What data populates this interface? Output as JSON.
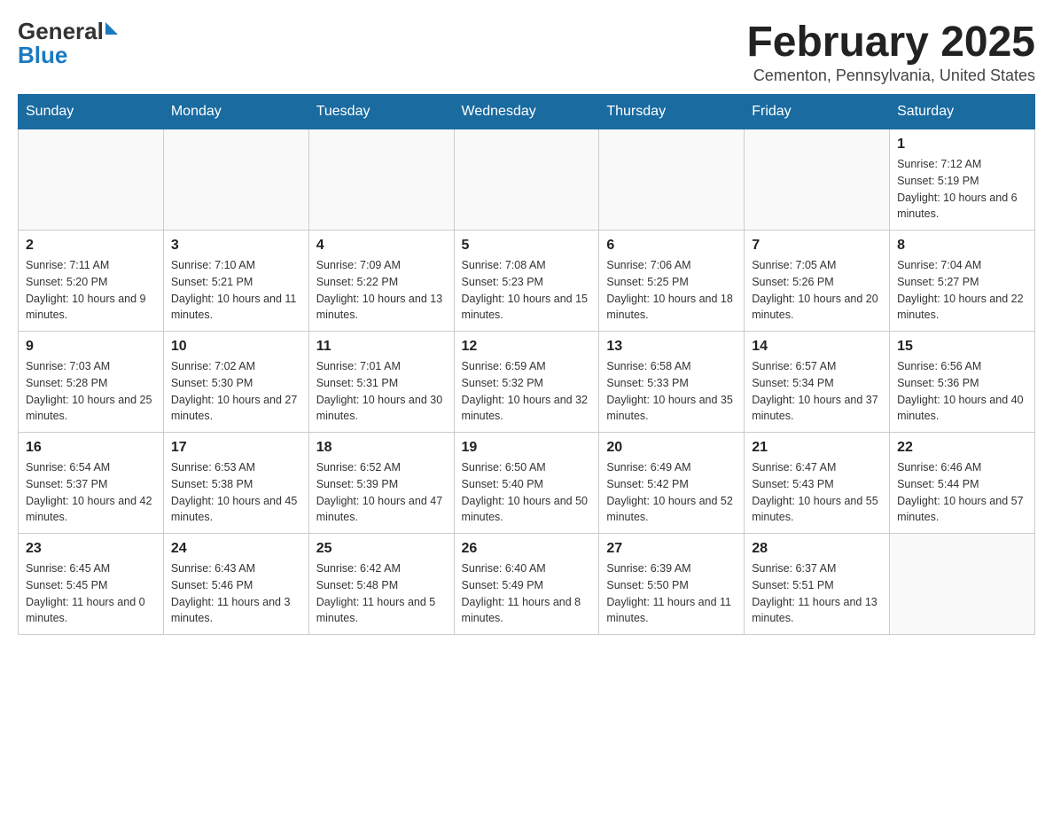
{
  "header": {
    "logo_general": "General",
    "logo_blue": "Blue",
    "title": "February 2025",
    "location": "Cementon, Pennsylvania, United States"
  },
  "days_of_week": [
    "Sunday",
    "Monday",
    "Tuesday",
    "Wednesday",
    "Thursday",
    "Friday",
    "Saturday"
  ],
  "weeks": [
    [
      {
        "day": "",
        "info": ""
      },
      {
        "day": "",
        "info": ""
      },
      {
        "day": "",
        "info": ""
      },
      {
        "day": "",
        "info": ""
      },
      {
        "day": "",
        "info": ""
      },
      {
        "day": "",
        "info": ""
      },
      {
        "day": "1",
        "info": "Sunrise: 7:12 AM\nSunset: 5:19 PM\nDaylight: 10 hours and 6 minutes."
      }
    ],
    [
      {
        "day": "2",
        "info": "Sunrise: 7:11 AM\nSunset: 5:20 PM\nDaylight: 10 hours and 9 minutes."
      },
      {
        "day": "3",
        "info": "Sunrise: 7:10 AM\nSunset: 5:21 PM\nDaylight: 10 hours and 11 minutes."
      },
      {
        "day": "4",
        "info": "Sunrise: 7:09 AM\nSunset: 5:22 PM\nDaylight: 10 hours and 13 minutes."
      },
      {
        "day": "5",
        "info": "Sunrise: 7:08 AM\nSunset: 5:23 PM\nDaylight: 10 hours and 15 minutes."
      },
      {
        "day": "6",
        "info": "Sunrise: 7:06 AM\nSunset: 5:25 PM\nDaylight: 10 hours and 18 minutes."
      },
      {
        "day": "7",
        "info": "Sunrise: 7:05 AM\nSunset: 5:26 PM\nDaylight: 10 hours and 20 minutes."
      },
      {
        "day": "8",
        "info": "Sunrise: 7:04 AM\nSunset: 5:27 PM\nDaylight: 10 hours and 22 minutes."
      }
    ],
    [
      {
        "day": "9",
        "info": "Sunrise: 7:03 AM\nSunset: 5:28 PM\nDaylight: 10 hours and 25 minutes."
      },
      {
        "day": "10",
        "info": "Sunrise: 7:02 AM\nSunset: 5:30 PM\nDaylight: 10 hours and 27 minutes."
      },
      {
        "day": "11",
        "info": "Sunrise: 7:01 AM\nSunset: 5:31 PM\nDaylight: 10 hours and 30 minutes."
      },
      {
        "day": "12",
        "info": "Sunrise: 6:59 AM\nSunset: 5:32 PM\nDaylight: 10 hours and 32 minutes."
      },
      {
        "day": "13",
        "info": "Sunrise: 6:58 AM\nSunset: 5:33 PM\nDaylight: 10 hours and 35 minutes."
      },
      {
        "day": "14",
        "info": "Sunrise: 6:57 AM\nSunset: 5:34 PM\nDaylight: 10 hours and 37 minutes."
      },
      {
        "day": "15",
        "info": "Sunrise: 6:56 AM\nSunset: 5:36 PM\nDaylight: 10 hours and 40 minutes."
      }
    ],
    [
      {
        "day": "16",
        "info": "Sunrise: 6:54 AM\nSunset: 5:37 PM\nDaylight: 10 hours and 42 minutes."
      },
      {
        "day": "17",
        "info": "Sunrise: 6:53 AM\nSunset: 5:38 PM\nDaylight: 10 hours and 45 minutes."
      },
      {
        "day": "18",
        "info": "Sunrise: 6:52 AM\nSunset: 5:39 PM\nDaylight: 10 hours and 47 minutes."
      },
      {
        "day": "19",
        "info": "Sunrise: 6:50 AM\nSunset: 5:40 PM\nDaylight: 10 hours and 50 minutes."
      },
      {
        "day": "20",
        "info": "Sunrise: 6:49 AM\nSunset: 5:42 PM\nDaylight: 10 hours and 52 minutes."
      },
      {
        "day": "21",
        "info": "Sunrise: 6:47 AM\nSunset: 5:43 PM\nDaylight: 10 hours and 55 minutes."
      },
      {
        "day": "22",
        "info": "Sunrise: 6:46 AM\nSunset: 5:44 PM\nDaylight: 10 hours and 57 minutes."
      }
    ],
    [
      {
        "day": "23",
        "info": "Sunrise: 6:45 AM\nSunset: 5:45 PM\nDaylight: 11 hours and 0 minutes."
      },
      {
        "day": "24",
        "info": "Sunrise: 6:43 AM\nSunset: 5:46 PM\nDaylight: 11 hours and 3 minutes."
      },
      {
        "day": "25",
        "info": "Sunrise: 6:42 AM\nSunset: 5:48 PM\nDaylight: 11 hours and 5 minutes."
      },
      {
        "day": "26",
        "info": "Sunrise: 6:40 AM\nSunset: 5:49 PM\nDaylight: 11 hours and 8 minutes."
      },
      {
        "day": "27",
        "info": "Sunrise: 6:39 AM\nSunset: 5:50 PM\nDaylight: 11 hours and 11 minutes."
      },
      {
        "day": "28",
        "info": "Sunrise: 6:37 AM\nSunset: 5:51 PM\nDaylight: 11 hours and 13 minutes."
      },
      {
        "day": "",
        "info": ""
      }
    ]
  ]
}
